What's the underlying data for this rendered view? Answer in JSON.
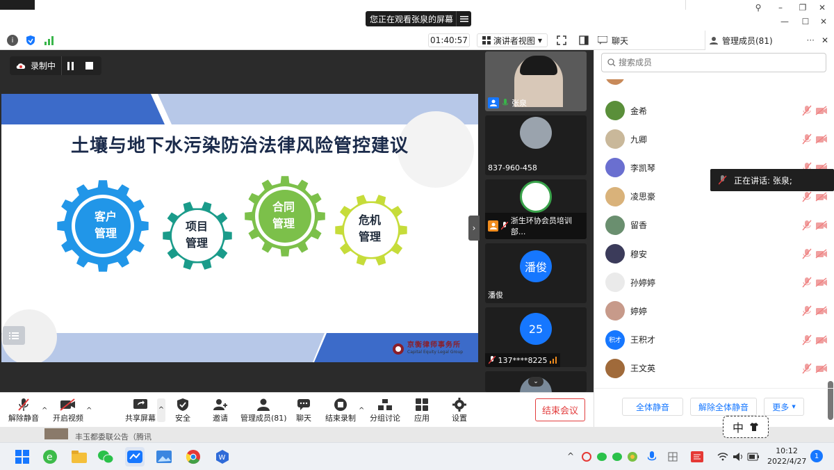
{
  "window": {
    "banner_text": "您正在观看张泉的屏幕",
    "timer": "01:40:57",
    "view_mode": "演讲者视图",
    "chat_tab": "聊天",
    "members_tab": "管理成员(81)"
  },
  "recording": {
    "label": "录制中"
  },
  "slide": {
    "title": "土壤与地下水污染防治法律风险管控建议",
    "gears": [
      {
        "line1": "客户",
        "line2": "管理",
        "color": "#2196e8"
      },
      {
        "line1": "项目",
        "line2": "管理",
        "color": "#1a9b8a"
      },
      {
        "line1": "合同",
        "line2": "管理",
        "color": "#7cc04a"
      },
      {
        "line1": "危机",
        "line2": "管理",
        "color": "#c6dc3a"
      }
    ],
    "logo_text": "京衡律师事务所",
    "logo_sub": "Capital Equity Legal Group"
  },
  "thumbs": [
    {
      "name": "张泉"
    },
    {
      "name": "837-960-458"
    },
    {
      "name": "浙生环协会员培训部..."
    },
    {
      "name": "潘俊",
      "avatar_text": "潘俊",
      "avatar_color": "#1677ff"
    },
    {
      "name": "137****8225",
      "avatar_text": "25",
      "avatar_color": "#1677ff"
    }
  ],
  "panel": {
    "search_placeholder": "搜索成员",
    "members": [
      {
        "name": "金希",
        "avatar_color": "#5a8f3a"
      },
      {
        "name": "九卿",
        "avatar_color": "#c9b89a"
      },
      {
        "name": "李凯琴",
        "avatar_color": "#6a6fd0"
      },
      {
        "name": "凌思豪",
        "avatar_color": "#d9b27a"
      },
      {
        "name": "留香",
        "avatar_color": "#6a8f6f"
      },
      {
        "name": "穆安",
        "avatar_color": "#3b3b5a"
      },
      {
        "name": "孙婷婷",
        "avatar_color": "#eaeaea"
      },
      {
        "name": "婷婷",
        "avatar_color": "#c79a8a"
      },
      {
        "name": "王积才",
        "avatar_color": "#1677ff",
        "avatar_text": "积才"
      },
      {
        "name": "王文英",
        "avatar_color": "#a06a3a"
      }
    ],
    "mute_all": "全体静音",
    "unmute_all": "解除全体静音",
    "more": "更多",
    "speaking_text": "正在讲话: 张泉;"
  },
  "toolbar": {
    "unmute": "解除静音",
    "start_video": "开启视频",
    "share_screen": "共享屏幕",
    "security": "安全",
    "invite": "邀请",
    "members": "管理成员(81)",
    "chat": "聊天",
    "stop_record": "结束录制",
    "breakout": "分组讨论",
    "apps": "应用",
    "settings": "设置",
    "end_meeting": "结束会议"
  },
  "ime": {
    "text": "中"
  },
  "taskbar": {
    "time": "10:12",
    "date": "2022/4/27",
    "notification_count": "1",
    "hidden_window_text": "丰玉都委联公告（腾讯"
  },
  "colors": {
    "accent": "#1677ff",
    "end_red": "#e23c3c"
  }
}
